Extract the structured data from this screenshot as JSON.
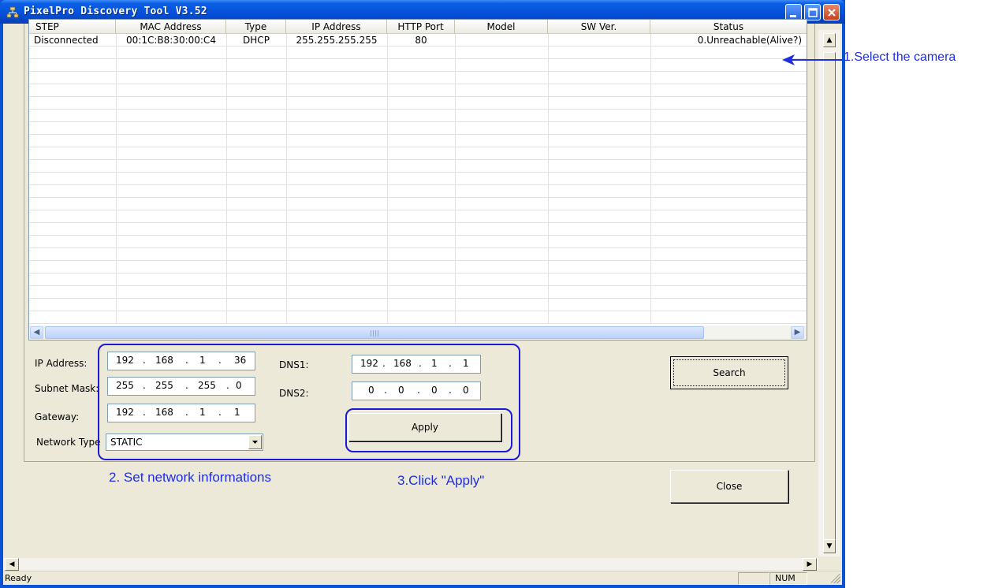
{
  "window": {
    "title": "PixelPro Discovery Tool V3.52"
  },
  "table": {
    "columns": [
      "STEP",
      "MAC Address",
      "Type",
      "IP Address",
      "HTTP Port",
      "Model",
      "SW Ver.",
      "Status"
    ],
    "rows": [
      {
        "step": "Disconnected",
        "mac": "00:1C:B8:30:00:C4",
        "type": "DHCP",
        "ip": "255.255.255.255",
        "port": "80",
        "model": "",
        "sw": "",
        "status": "0.Unreachable(Alive?)"
      }
    ]
  },
  "form": {
    "ip_label": "IP Address:",
    "ip": [
      "192",
      "168",
      "1",
      "36"
    ],
    "mask_label": "Subnet Mask:",
    "mask": [
      "255",
      "255",
      "255",
      "0"
    ],
    "gateway_label": "Gateway:",
    "gateway": [
      "192",
      "168",
      "1",
      "1"
    ],
    "nettype_label": "Network Type",
    "nettype": "STATIC",
    "dns1_label": "DNS1:",
    "dns1": [
      "192",
      "168",
      "1",
      "1"
    ],
    "dns2_label": "DNS2:",
    "dns2": [
      "0",
      "0",
      "0",
      "0"
    ]
  },
  "buttons": {
    "search": "Search",
    "apply": "Apply",
    "close": "Close"
  },
  "annotations": {
    "select": "1.Select the camera",
    "set": "2. Set network informations",
    "apply": "3.Click \"Apply\""
  },
  "statusbar": {
    "text": "Ready",
    "num": "NUM"
  },
  "colors": {
    "annotation": "#1f2ee0",
    "titlebar": "#0553dd"
  }
}
